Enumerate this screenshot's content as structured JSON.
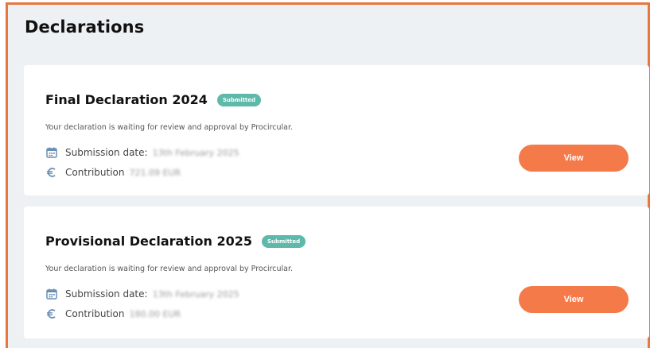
{
  "page": {
    "title": "Declarations"
  },
  "declarations": [
    {
      "title": "Final Declaration 2024",
      "status": "Submitted",
      "description": "Your declaration is waiting for review and approval by Procircular.",
      "submission_label": "Submission date:",
      "submission_value": "13th February 2025",
      "contribution_label": "Contribution",
      "contribution_value": "721.09 EUR",
      "view_label": "View"
    },
    {
      "title": "Provisional Declaration 2025",
      "status": "Submitted",
      "description": "Your declaration is waiting for review and approval by Procircular.",
      "submission_label": "Submission date:",
      "submission_value": "13th February 2025",
      "contribution_label": "Contribution",
      "contribution_value": "180.00 EUR",
      "view_label": "View"
    }
  ],
  "colors": {
    "accent": "#f47a4a",
    "badge": "#5fb9aa",
    "icon": "#6a8fb3",
    "frame": "#e8763f",
    "panel": "#eef1f4"
  },
  "icons": {
    "calendar": "calendar-icon",
    "euro": "euro-icon"
  }
}
